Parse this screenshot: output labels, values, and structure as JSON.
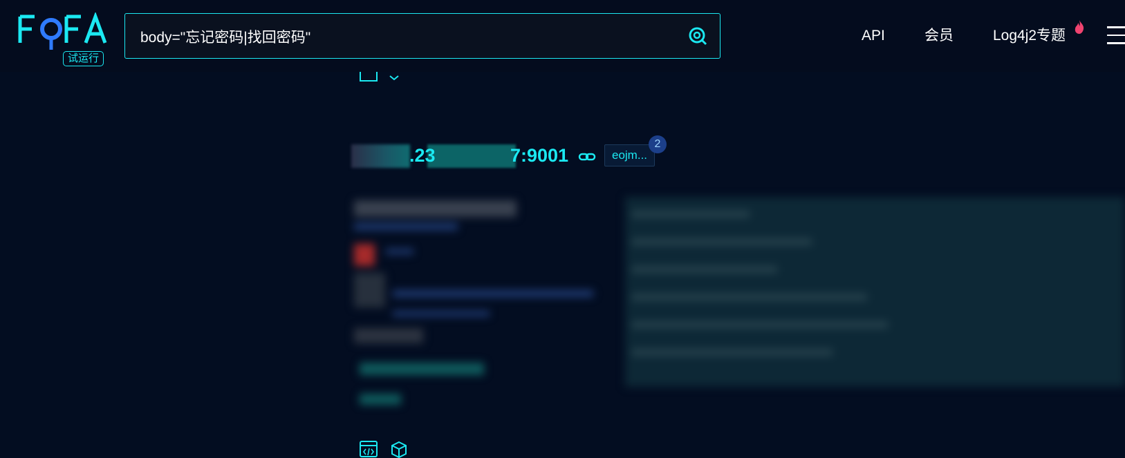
{
  "header": {
    "logo_text": "FOFA",
    "logo_badge": "试运行",
    "search": {
      "value": "body=\"忘记密码|找回密码\""
    },
    "nav": {
      "api": "API",
      "member": "会员",
      "log4j": "Log4j2专题"
    }
  },
  "result": {
    "host_part1": ".23",
    "host_part2": "7:9001",
    "tag_label": "eojm...",
    "tag_count": "2"
  },
  "colors": {
    "accent": "#1be9f2",
    "background": "#030d21",
    "header_bg": "#040c1e",
    "fire": "#f0436f"
  }
}
